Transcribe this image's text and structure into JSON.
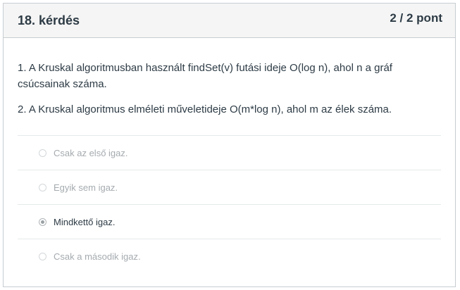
{
  "question": {
    "title": "18. kérdés",
    "points": "2 / 2 pont",
    "statements": [
      "1. A Kruskal algoritmusban használt findSet(v) futási ideje O(log n), ahol n a gráf csúcsainak száma.",
      "2. A Kruskal algoritmus elméleti műveletideje O(m*log n), ahol m az élek száma."
    ],
    "answers": [
      {
        "label": "Csak az első igaz.",
        "selected": false
      },
      {
        "label": "Egyik sem igaz.",
        "selected": false
      },
      {
        "label": "Mindkettő igaz.",
        "selected": true
      },
      {
        "label": "Csak a második igaz.",
        "selected": false
      }
    ]
  }
}
